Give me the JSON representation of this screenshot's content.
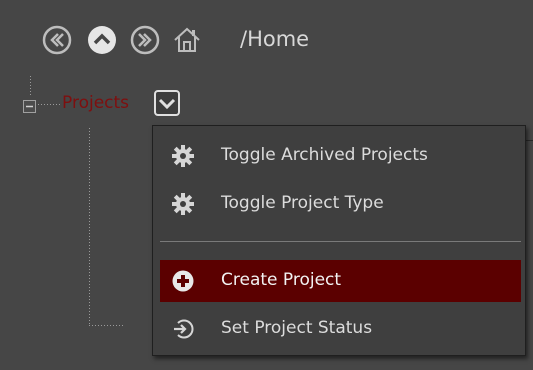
{
  "nav": {
    "back_icon": "back-circle-icon",
    "up_icon": "up-circle-icon",
    "forward_icon": "forward-circle-icon",
    "home_icon": "home-icon",
    "path": "/Home"
  },
  "tree": {
    "root_label": "Projects",
    "expand_state": "expanded"
  },
  "menu": {
    "items": [
      {
        "label": "Toggle Archived Projects",
        "icon": "gear-icon"
      },
      {
        "label": "Toggle Project Type",
        "icon": "gear-icon"
      },
      {
        "label": "Create Project",
        "icon": "plus-circle-icon",
        "selected": true
      },
      {
        "label": "Set Project Status",
        "icon": "enter-circle-icon"
      }
    ]
  },
  "colors": {
    "background": "#464646",
    "menu_background": "#3f3f3f",
    "selected_row": "#5b0000",
    "tree_root_text": "#7e0f0f",
    "icon_light": "#d6d6d6"
  }
}
